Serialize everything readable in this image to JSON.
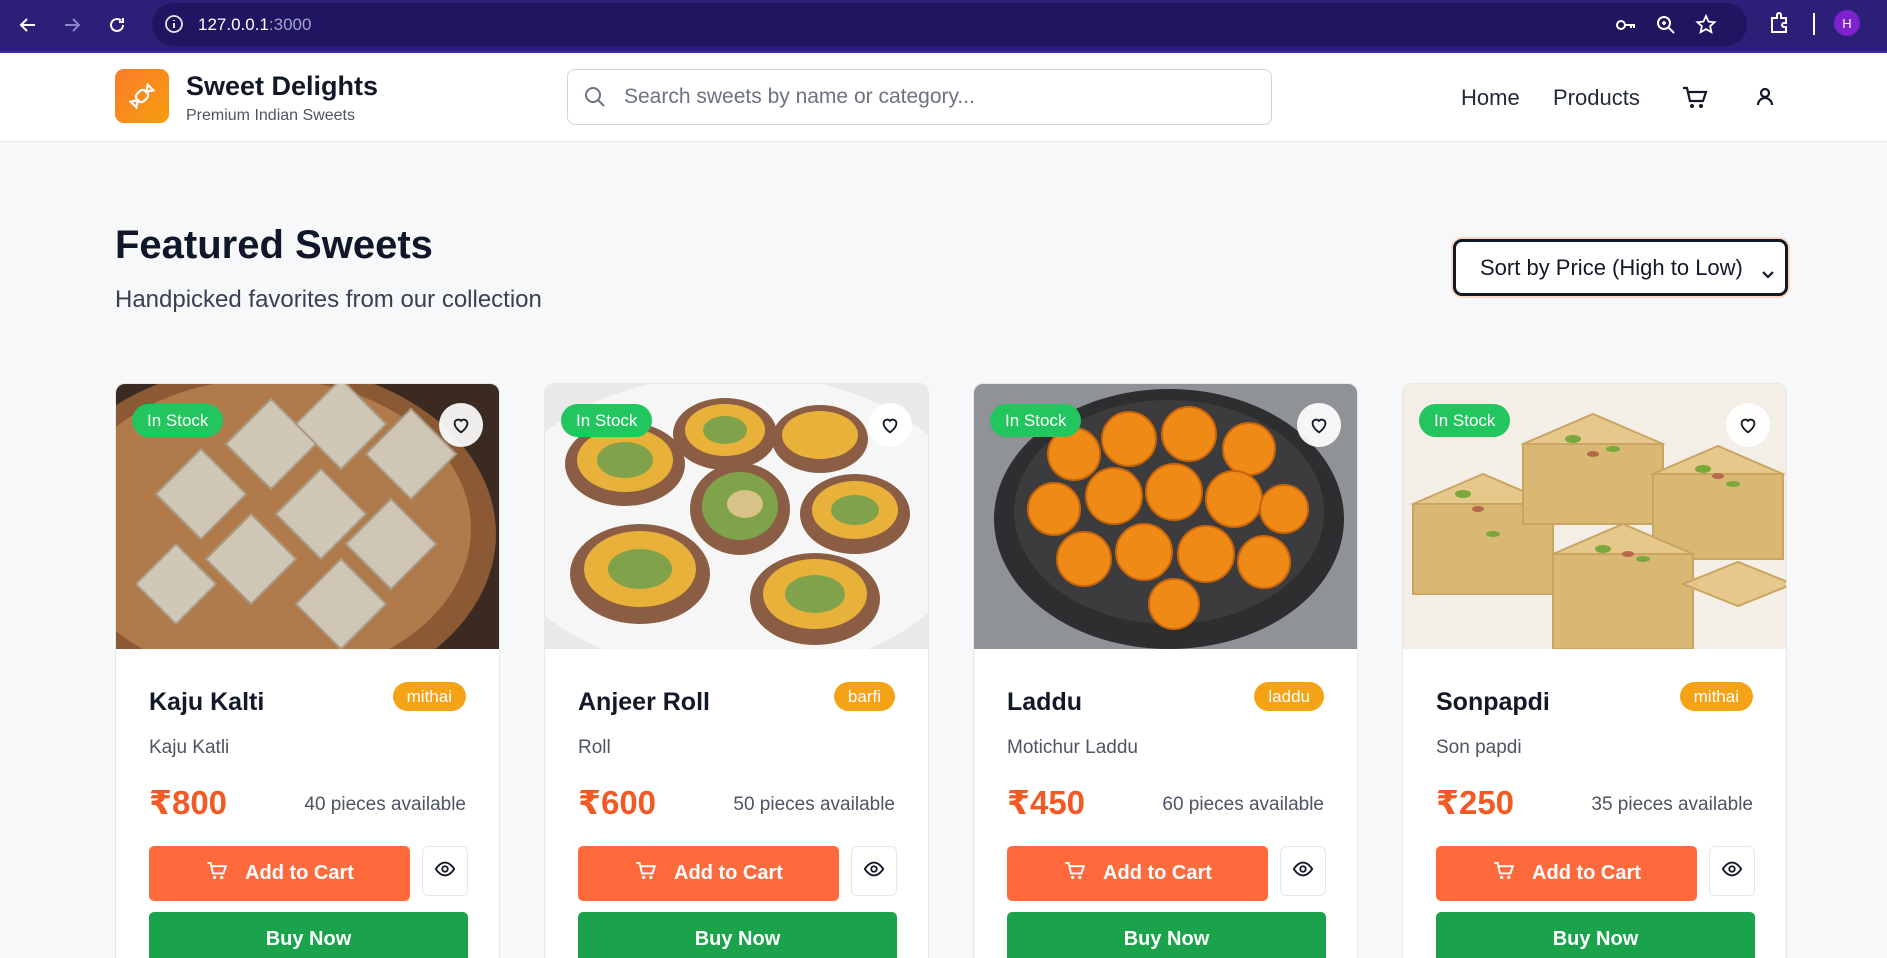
{
  "browser": {
    "url_host": "127.0.0.1",
    "url_port": ":3000",
    "profile_initial": "H"
  },
  "header": {
    "brand_name": "Sweet Delights",
    "brand_tagline": "Premium Indian Sweets",
    "search_placeholder": "Search sweets by name or category...",
    "nav": [
      "Home",
      "Products"
    ]
  },
  "main": {
    "title": "Featured Sweets",
    "subtitle": "Handpicked favorites from our collection",
    "sort_selected": "Sort by Price (High to Low)"
  },
  "products": [
    {
      "name": "Kaju Kalti",
      "category": "mithai",
      "description": "Kaju Katli",
      "price": "₹800",
      "stock": "40 pieces available",
      "status": "In Stock",
      "add_label": "Add to Cart",
      "buy_label": "Buy Now"
    },
    {
      "name": "Anjeer Roll",
      "category": "barfi",
      "description": "Roll",
      "price": "₹600",
      "stock": "50 pieces available",
      "status": "In Stock",
      "add_label": "Add to Cart",
      "buy_label": "Buy Now"
    },
    {
      "name": "Laddu",
      "category": "laddu",
      "description": "Motichur Laddu",
      "price": "₹450",
      "stock": "60 pieces available",
      "status": "In Stock",
      "add_label": "Add to Cart",
      "buy_label": "Buy Now"
    },
    {
      "name": "Sonpapdi",
      "category": "mithai",
      "description": "Son papdi",
      "price": "₹250",
      "stock": "35 pieces available",
      "status": "In Stock",
      "add_label": "Add to Cart",
      "buy_label": "Buy Now"
    }
  ],
  "colors": {
    "accent_orange": "#ff6a3d",
    "buy_green": "#1aa34a",
    "in_stock_green": "#22c55e",
    "category_amber": "#f5a316"
  }
}
